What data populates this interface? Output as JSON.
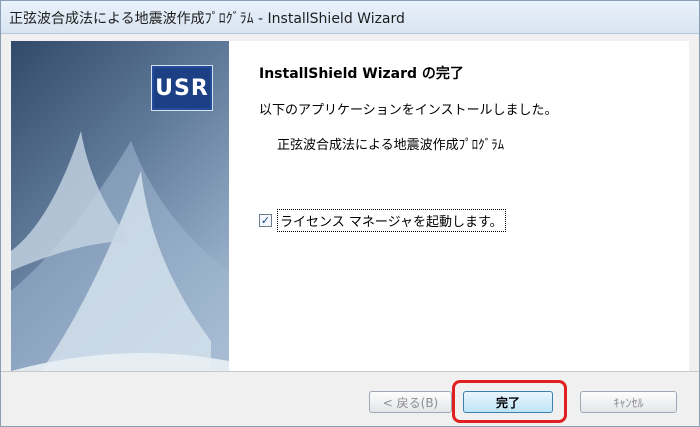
{
  "window": {
    "title": "正弦波合成法による地震波作成ﾌﾟﾛｸﾞﾗﾑ - InstallShield Wizard"
  },
  "left_panel": {
    "logo_text": "USR"
  },
  "main": {
    "heading": "InstallShield Wizard の完了",
    "message": "以下のアプリケーションをインストールしました。",
    "app_name": "正弦波合成法による地震波作成ﾌﾟﾛｸﾞﾗﾑ",
    "checkbox": {
      "label": "ライセンス マネージャを起動します。",
      "checked": true,
      "check_glyph": "✓"
    }
  },
  "footer": {
    "back_label": "< 戻る(B)",
    "finish_label": "完了",
    "cancel_label": "ｷｬﾝｾﾙ"
  },
  "colors": {
    "highlight": "#e02020",
    "logo_bg": "#1d3f84"
  }
}
